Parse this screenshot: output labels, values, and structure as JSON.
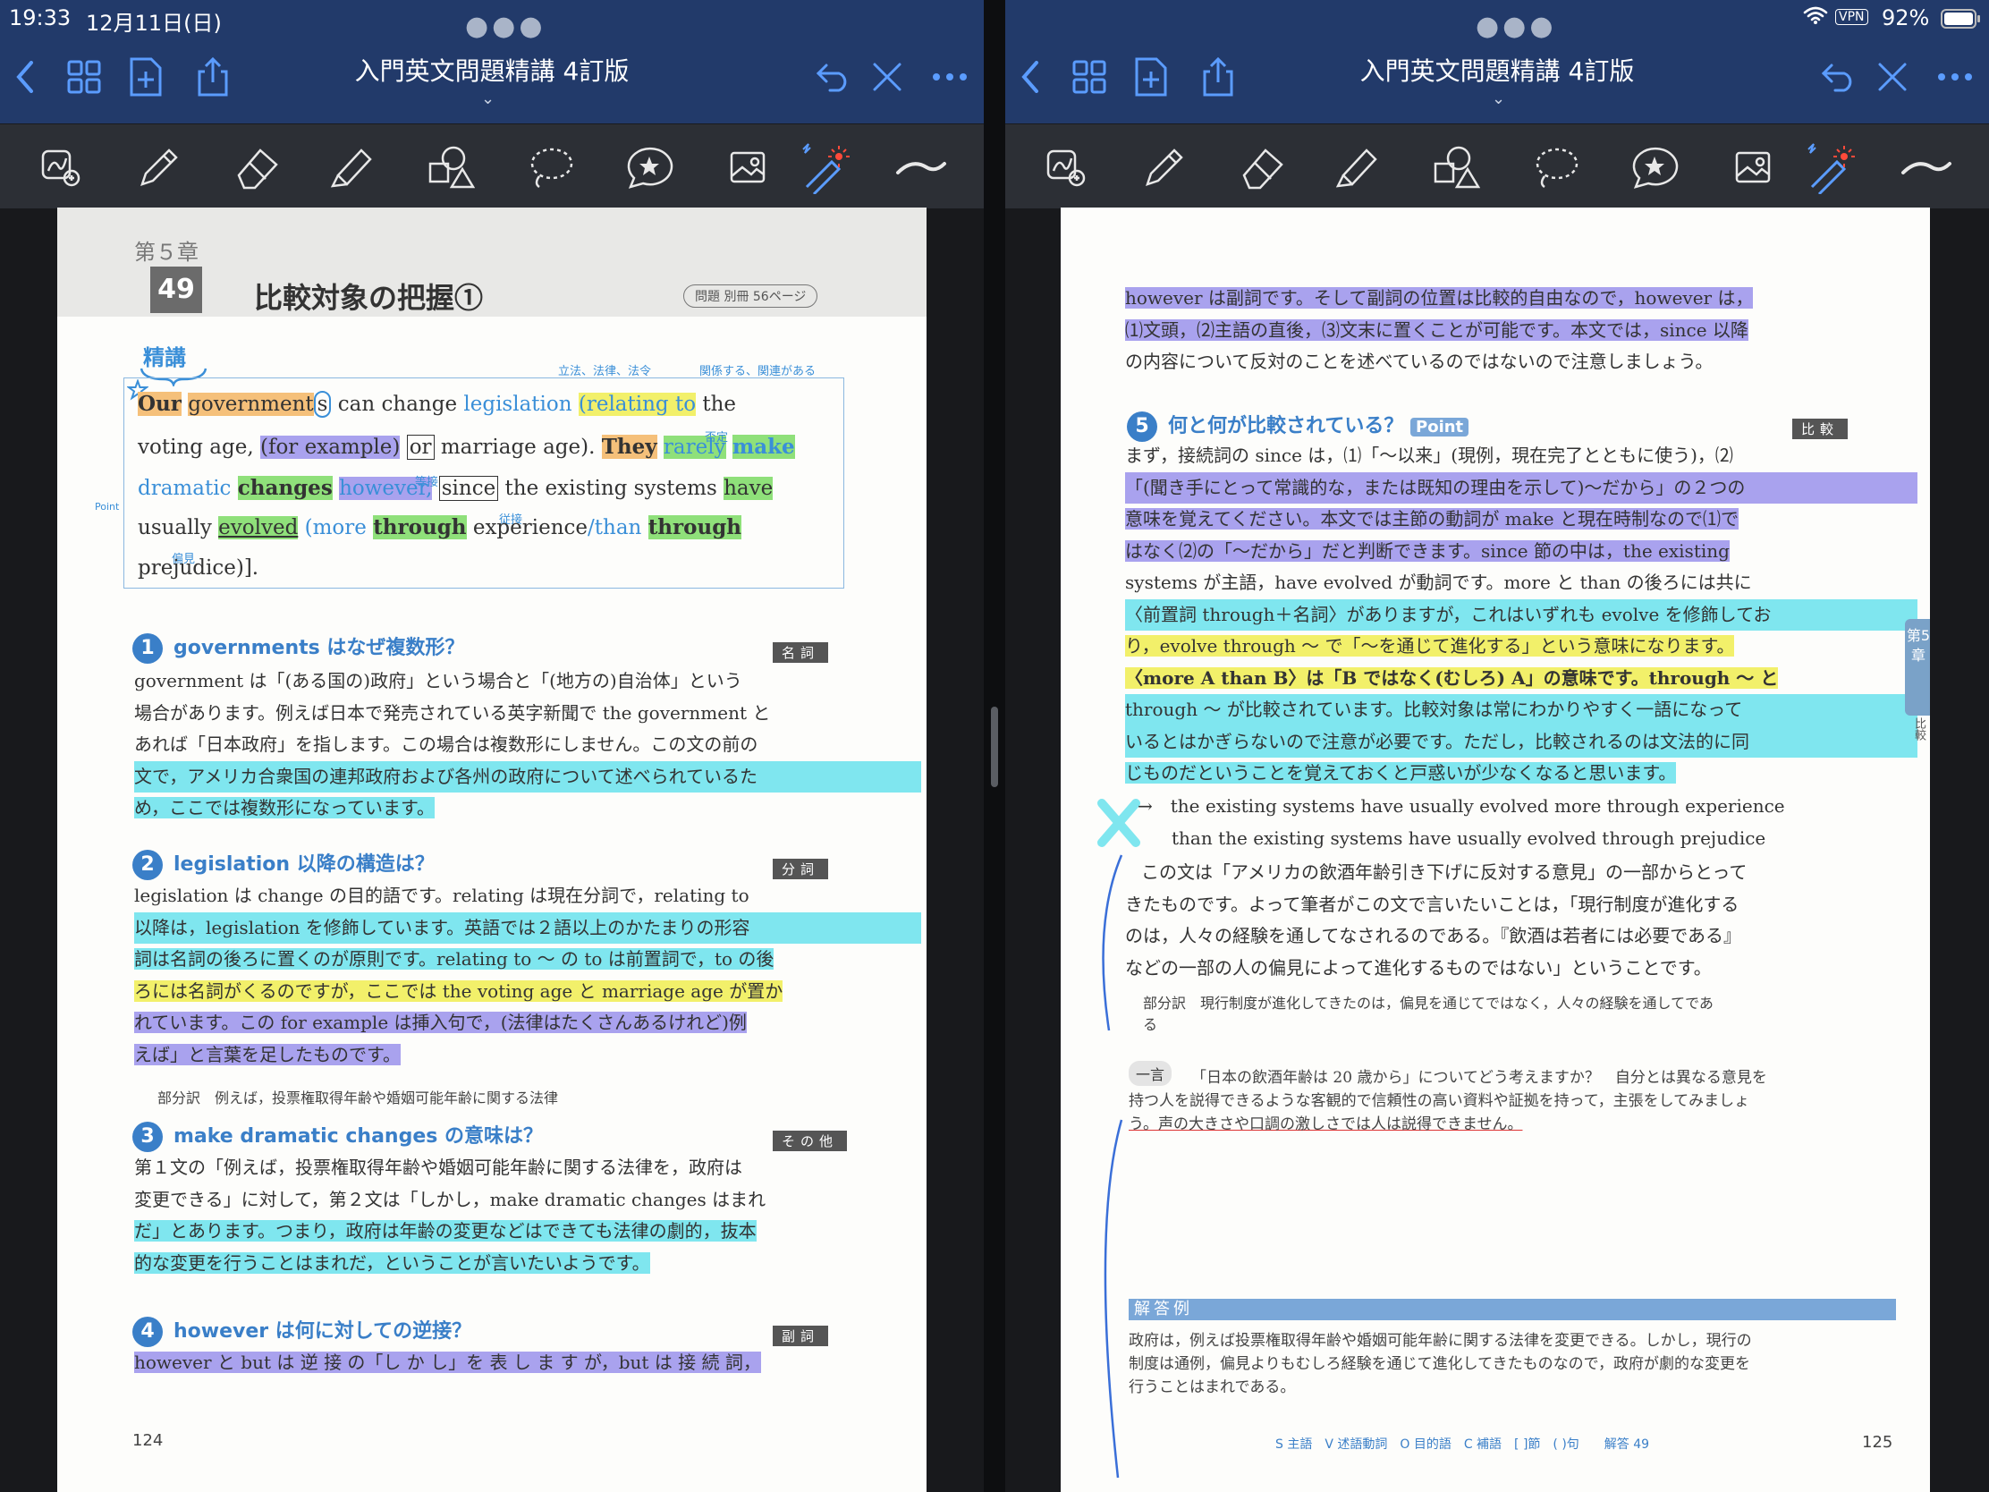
{
  "status": {
    "time": "19:33",
    "date": "12月11日(日)",
    "vpn": "VPN",
    "battery": "92%"
  },
  "app": {
    "title": "入門英文問題精講 4訂版"
  },
  "left": {
    "chapter": "第５章",
    "section_number": "49",
    "section_title": "比較対象の把握①",
    "ref": "問題 別冊 56ページ",
    "seiko": "精講",
    "ann_1": "立法、法律、法令",
    "ann_2": "関係する、関連がある",
    "ann_3": "否定",
    "ann_4": "等接",
    "ann_5": "従接",
    "ann_6": "偏見",
    "point": "Point",
    "eng_1a": "Our",
    "eng_1b": "government",
    "eng_1c": "s",
    "eng_1d": "can change",
    "eng_1e": "legislation",
    "eng_1f": "(relating to",
    "eng_1g": "the",
    "eng_2a": "voting age,",
    "eng_2b": "(for example)",
    "eng_2c": "or",
    "eng_2d": "marriage age).",
    "eng_2e": "They",
    "eng_2f": "rarely",
    "eng_2g": "make",
    "eng_3a": "dramatic",
    "eng_3b": "changes",
    "eng_3c": "however,",
    "eng_3d": "since",
    "eng_3e": "the existing systems",
    "eng_3f": "have",
    "eng_4a": "usually",
    "eng_4b": "evolved",
    "eng_4c": "(more",
    "eng_4d": "through",
    "eng_4e": "experience",
    "eng_4f": "/than",
    "eng_4g": "through",
    "eng_5": "prejudice)].",
    "q1_title": "governments はなぜ複数形？",
    "q1_tag": "名詞",
    "q1_text": [
      "government は「(ある国の)政府」という場合と「(地方の)自治体」という",
      "場合があります。例えば日本で発売されている英字新聞で the government と",
      "あれば「日本政府」を指します。この場合は複数形にしません。この文の前の",
      "文で，アメリカ合衆国の連邦政府および各州の政府について述べられているた",
      "め，ここでは複数形になっています。"
    ],
    "q2_title": "legislation 以降の構造は？",
    "q2_tag": "分詞",
    "q2_text": [
      "legislation は change の目的語です。relating は現在分詞で，relating to",
      "以降は，legislation を修飾しています。英語では２語以上のかたまりの形容",
      "詞は名詞の後ろに置くのが原則です。relating to ～ の to は前置詞で，to の後",
      "ろには名詞がくるのですが，ここでは the voting age と marriage age が置か",
      "れています。この for example は挿入句で，(法律はたくさんあるけれど)例",
      "えば」と言葉を足したものです。"
    ],
    "q2_note": "部分訳　例えば，投票権取得年齢や婚姻可能年齢に関する法律",
    "q3_title": "make dramatic changes の意味は？",
    "q3_tag": "その他",
    "q3_text": [
      "第１文の「例えば，投票権取得年齢や婚姻可能年齢に関する法律を，政府は",
      "変更できる」に対して，第２文は「しかし，make dramatic changes はまれ",
      "だ」とあります。つまり，政府は年齢の変更などはできても法律の劇的，抜本",
      "的な変更を行うことはまれだ，ということが言いたいようです。"
    ],
    "q4_title": "however は何に対しての逆接？",
    "q4_tag": "副詞",
    "q4_text": "however と but は 逆 接 の「し か し」を 表 し ま す が，but は 接 続 詞，",
    "page_number": "124"
  },
  "right": {
    "top_text": [
      "however は副詞です。そして副詞の位置は比較的自由なので，however は，",
      "⑴文頭，⑵主語の直後，⑶文末に置くことが可能です。本文では，since 以降",
      "の内容について反対のことを述べているのではないので注意しましょう。"
    ],
    "q5_title": "何と何が比較されている？",
    "q5_point": "Point",
    "q5_tag": "比較",
    "q5_text": [
      "まず，接続詞の since は，⑴「～以来」(現例，現在完了とともに使う)，⑵",
      "「(聞き手にとって常識的な，または既知の理由を示して)～だから」の２つの",
      "意味を覚えてください。本文では主節の動詞が make と現在時制なので⑴で",
      "はなく⑵の「～だから」だと判断できます。since 節の中は，the existing",
      "systems が主語，have evolved が動詞です。more と than の後ろには共に",
      "〈前置詞 through＋名詞〉がありますが，これはいずれも evolve を修飾してお",
      "り，evolve through ～ で「～を通じて進化する」という意味になります。",
      "〈more A than B〉は「B ではなく(むしろ) A」の意味です。through ～ と",
      "through ～ が比較されています。比較対象は常にわかりやすく一語になって",
      "いるとはかぎらないので注意が必要です。ただし，比較されるのは文法的に同",
      "じものだということを覚えておくと戸惑いが少なくなると思います。"
    ],
    "ex_line1": "→　the existing systems have usually evolved  more through experience",
    "ex_line2": "than the existing systems have usually evolved through prejudice",
    "mid_text": [
      "この文は「アメリカの飲酒年齢引き下げに反対する意見」の一部からとって",
      "きたものです。よって筆者がこの文で言いたいことは，「現行制度が進化する",
      "のは，人々の経験を通してなされるのである。『飲酒は若者には必要である』",
      "などの一部の人の偏見によって進化するものではない」ということです。"
    ],
    "mid_note": "部分訳　現行制度が進化してきたのは，偏見を通じてではなく，人々の経験を通してであ",
    "mid_note2": "る",
    "hitokoto": "一言",
    "hitokoto_text": [
      "「日本の飲酒年齢は 20 歳から」についてどう考えますか？　自分とは異なる意見を",
      "持つ人を説得できるような客観的で信頼性の高い資料や証拠を持って，主張をしてみましょ",
      "う。声の大きさや口調の激しさでは人は説得できません。"
    ],
    "answer_label": "解答例",
    "answer_text": [
      "政府は，例えば投票権取得年齢や婚姻可能年齢に関する法律を変更できる。しかし，現行の",
      "制度は通例，偏見よりもむしろ経験を通じて進化してきたものなので，政府が劇的な変更を",
      "行うことはまれである。"
    ],
    "side_tab": "第5章",
    "side_tab2": "比較",
    "legend": "S 主語　V 述語動詞　O 目的語　C 補語　[ ]節　( )句　　解答 49",
    "page_number": "125"
  },
  "colors": {
    "nav": "#223a6a",
    "accent": "#5b9cff",
    "toolbar": "#2c2f35",
    "heading_blue": "#3a7fc8"
  }
}
